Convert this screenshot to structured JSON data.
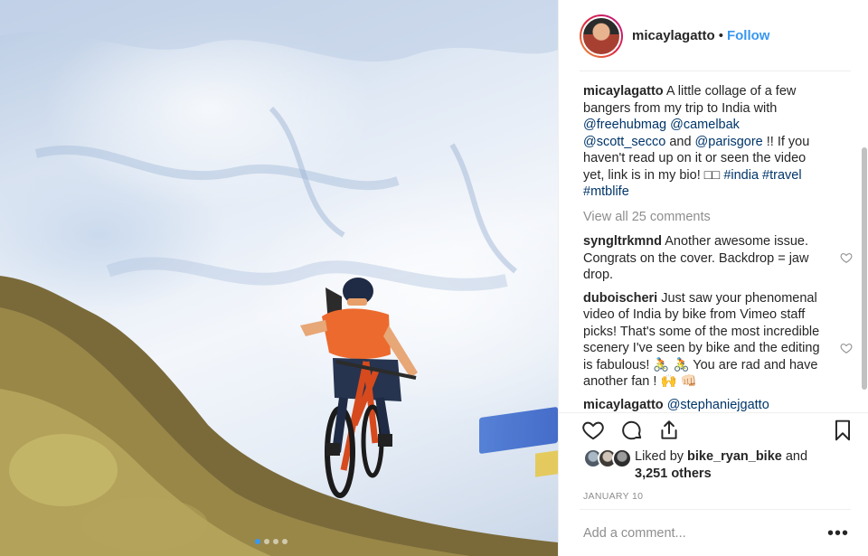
{
  "post": {
    "photo_alt_icon": "mountain-bike-photo",
    "carousel": {
      "count": 4,
      "active_index": 0
    }
  },
  "header": {
    "username": "micaylagatto",
    "separator": "•",
    "follow_label": "Follow"
  },
  "caption": {
    "username": "micaylagatto",
    "text_1": " A little collage of a few bangers from my trip to India with ",
    "mention_1": "@freehubmag",
    "mention_2": "@camelbak",
    "mention_3": "@scott_secco",
    "text_2": " and ",
    "mention_4": "@parisgore",
    "text_3": " !! If you haven't read up on it or seen the video yet, link is in my bio! □□ ",
    "hashtag_1": "#india",
    "hashtag_2": "#travel",
    "hashtag_3": "#mtblife"
  },
  "view_all_label": "View all 25 comments",
  "comments": [
    {
      "username": "syngltrkmnd",
      "text": " Another awesome issue. Congrats on the cover. Backdrop = jaw drop."
    },
    {
      "username": "duboischeri",
      "text": " Just saw your phenomenal video of India by bike from Vimeo staff picks! That's some of the most incredible scenery I've seen by bike and the editing is fabulous! 🚴 🚴 You are rad and have another fan ! 🙌 👊🏻"
    },
    {
      "username": "micaylagatto",
      "mention": "@stephaniejgatto"
    }
  ],
  "likes": {
    "prefix": "Liked by ",
    "user": "bike_ryan_bike",
    "middle": " and ",
    "others": "3,251 others"
  },
  "date": "JANUARY 10",
  "comment_box": {
    "placeholder": "Add a comment...",
    "more_label": "•••"
  },
  "colors": {
    "link": "#3897f0",
    "mention": "#003569",
    "muted": "#8e8e8e",
    "text": "#262626"
  }
}
